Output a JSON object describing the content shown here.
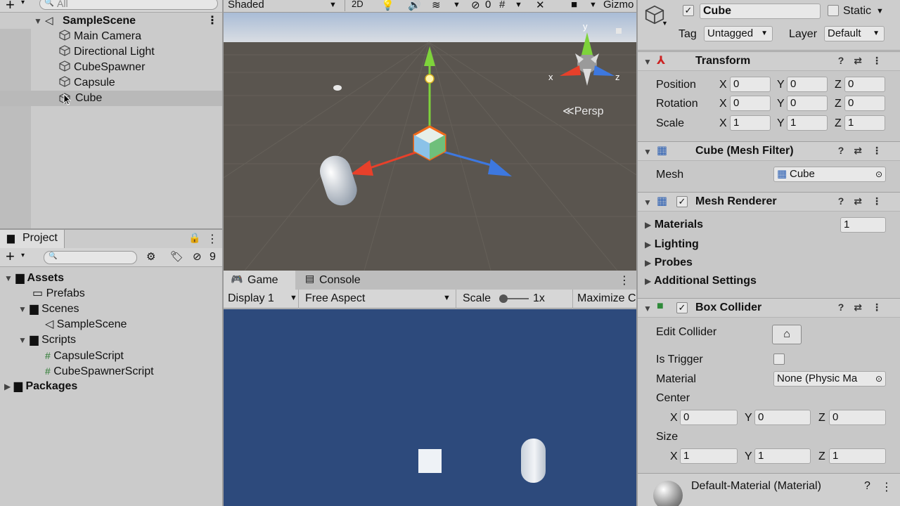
{
  "hierarchy": {
    "search_placeholder": "All",
    "scene": "SampleScene",
    "items": [
      "Main Camera",
      "Directional Light",
      "CubeSpawner",
      "Capsule",
      "Cube"
    ]
  },
  "scene_toolbar": {
    "shading": "Shaded",
    "mode_2d": "2D",
    "hidden_count": "0",
    "gizmos": "Gizmo"
  },
  "scene_view": {
    "projection": "Persp",
    "axis_y": "y",
    "axis_x": "x",
    "axis_z": "z"
  },
  "project": {
    "tab": "Project",
    "hidden_count": "9",
    "tree": [
      "Assets",
      "Prefabs",
      "Scenes",
      "SampleScene",
      "Scripts",
      "CapsuleScript",
      "CubeSpawnerScript",
      "Packages"
    ]
  },
  "game": {
    "tabs": [
      "Game",
      "Console"
    ],
    "display": "Display 1",
    "aspect": "Free Aspect",
    "scale_label": "Scale",
    "scale_value": "1x",
    "maximize": "Maximize C"
  },
  "inspector": {
    "object_name": "Cube",
    "static_label": "Static",
    "tag_label": "Tag",
    "tag_value": "Untagged",
    "layer_label": "Layer",
    "layer_value": "Default",
    "transform": {
      "title": "Transform",
      "rows": [
        {
          "label": "Position",
          "x": "0",
          "y": "0",
          "z": "0"
        },
        {
          "label": "Rotation",
          "x": "0",
          "y": "0",
          "z": "0"
        },
        {
          "label": "Scale",
          "x": "1",
          "y": "1",
          "z": "1"
        }
      ]
    },
    "mesh_filter": {
      "title": "Cube (Mesh Filter)",
      "mesh_label": "Mesh",
      "mesh_value": "Cube"
    },
    "mesh_renderer": {
      "title": "Mesh Renderer",
      "sections": [
        "Materials",
        "Lighting",
        "Probes",
        "Additional Settings"
      ],
      "materials_count": "1"
    },
    "box_collider": {
      "title": "Box Collider",
      "edit_collider": "Edit Collider",
      "is_trigger": "Is Trigger",
      "material_label": "Material",
      "material_value": "None (Physic Ma",
      "center_label": "Center",
      "center": {
        "x": "0",
        "y": "0",
        "z": "0"
      },
      "size_label": "Size",
      "size": {
        "x": "1",
        "y": "1",
        "z": "1"
      }
    },
    "material_asset": "Default-Material (Material)"
  },
  "colors": {
    "game_bg": "#2d4a7c",
    "scene_ground": "#5a554f",
    "selection": "#f26a1b",
    "x_axis": "#e8402a",
    "y_axis": "#7ed33b",
    "z_axis": "#3d78e0"
  }
}
